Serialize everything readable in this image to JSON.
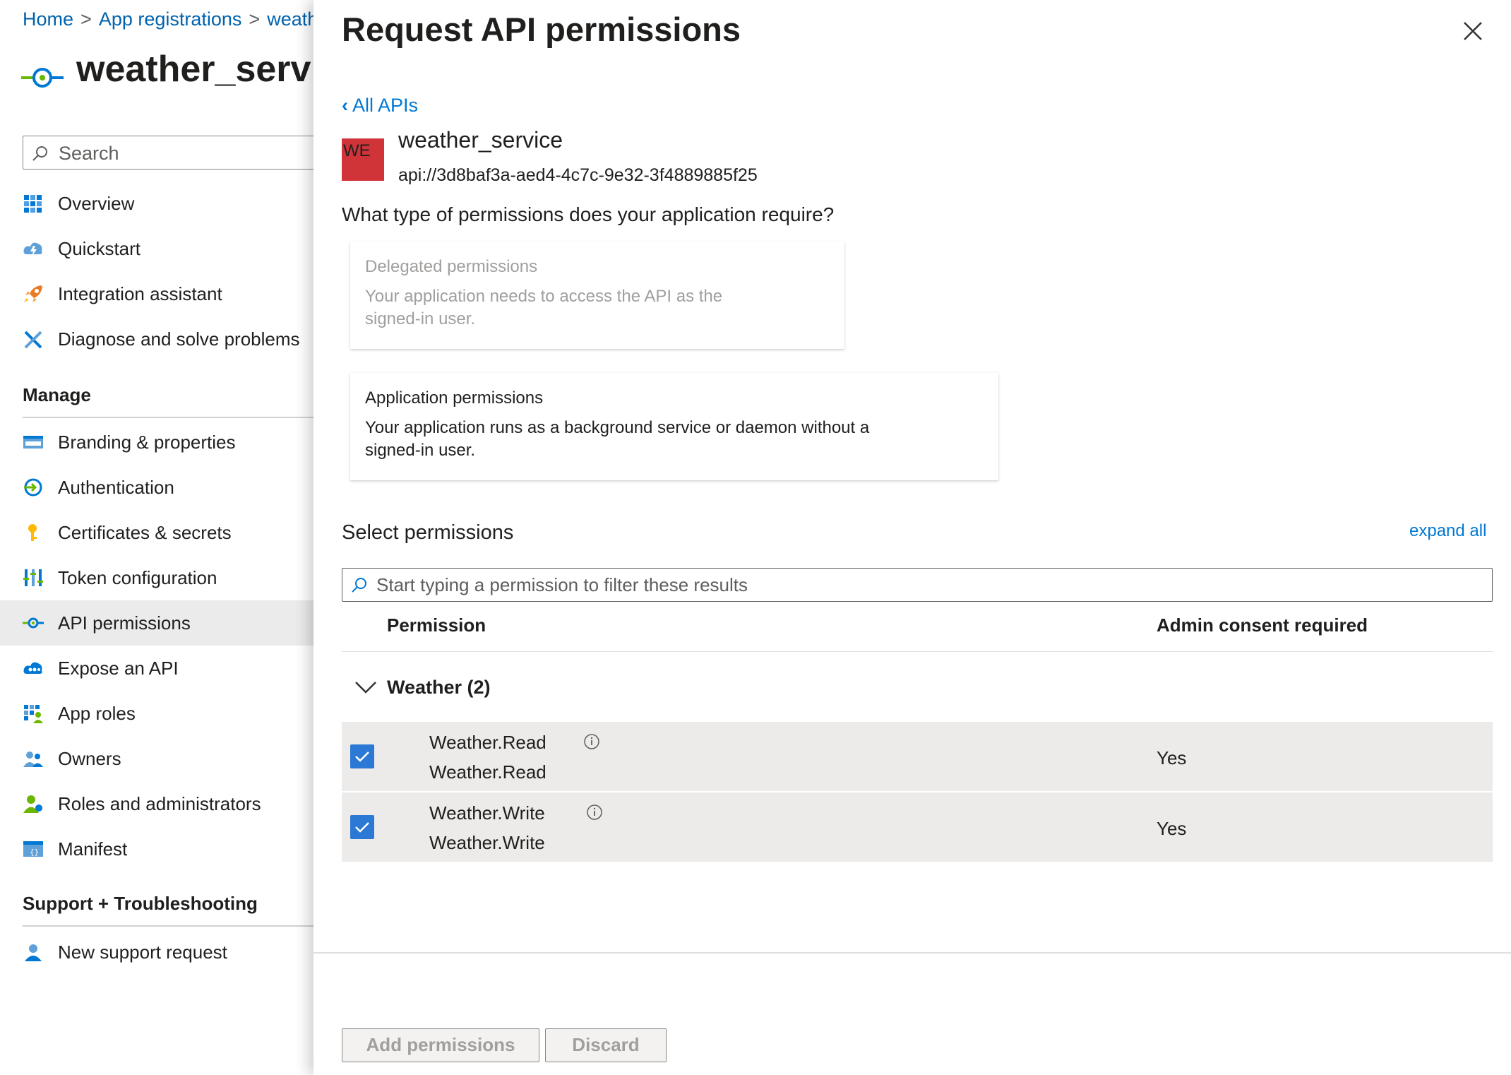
{
  "breadcrumb": {
    "items": [
      "Home",
      "App registrations",
      "weather_service"
    ]
  },
  "app": {
    "title": "weather_service"
  },
  "left_search": {
    "placeholder": "Search"
  },
  "nav": {
    "top_items": [
      {
        "label": "Overview",
        "icon": "grid-icon"
      },
      {
        "label": "Quickstart",
        "icon": "cloud-bolt-icon"
      },
      {
        "label": "Integration assistant",
        "icon": "rocket-icon"
      },
      {
        "label": "Diagnose and solve problems",
        "icon": "wrench-icon"
      }
    ],
    "manage_heading": "Manage",
    "manage_items": [
      {
        "label": "Branding & properties",
        "icon": "branding-icon"
      },
      {
        "label": "Authentication",
        "icon": "auth-icon"
      },
      {
        "label": "Certificates & secrets",
        "icon": "key-icon"
      },
      {
        "label": "Token configuration",
        "icon": "token-bars-icon"
      },
      {
        "label": "API permissions",
        "icon": "api-permissions-icon",
        "active": true
      },
      {
        "label": "Expose an API",
        "icon": "cloud-api-icon"
      },
      {
        "label": "App roles",
        "icon": "app-roles-icon"
      },
      {
        "label": "Owners",
        "icon": "owners-icon"
      },
      {
        "label": "Roles and administrators",
        "icon": "admin-icon"
      },
      {
        "label": "Manifest",
        "icon": "manifest-icon"
      }
    ],
    "support_heading": "Support + Troubleshooting",
    "support_items": [
      {
        "label": "New support request",
        "icon": "support-person-icon"
      }
    ]
  },
  "panel": {
    "title": "Request API permissions",
    "back_link": "All APIs",
    "api": {
      "badge": "WE",
      "name": "weather_service",
      "uri": "api://3d8baf3a-aed4-4c7c-9e32-3f4889885f25"
    },
    "question": "What type of permissions does your application require?",
    "delegated": {
      "title": "Delegated permissions",
      "desc_line1": "Your application needs to access the API as the",
      "desc_line2": "signed-in user."
    },
    "application": {
      "title": "Application permissions",
      "desc_line1": "Your application runs as a background service or daemon without a",
      "desc_line2": "signed-in user."
    },
    "select_heading": "Select permissions",
    "expand_all": "expand all",
    "filter_placeholder": "Start typing a permission to filter these results",
    "columns": {
      "permission": "Permission",
      "consent": "Admin consent required"
    },
    "group": {
      "label": "Weather (2)"
    },
    "rows": [
      {
        "name": "Weather.Read",
        "description": "Weather.Read",
        "consent": "Yes",
        "checked": true
      },
      {
        "name": "Weather.Write",
        "description": "Weather.Write",
        "consent": "Yes",
        "checked": true
      }
    ],
    "buttons": {
      "add": "Add permissions",
      "discard": "Discard"
    }
  },
  "colors": {
    "accent": "#0078d4",
    "checkbox": "#2b79d4",
    "badge": "#d13438",
    "active_nav": "#ebebeb"
  }
}
